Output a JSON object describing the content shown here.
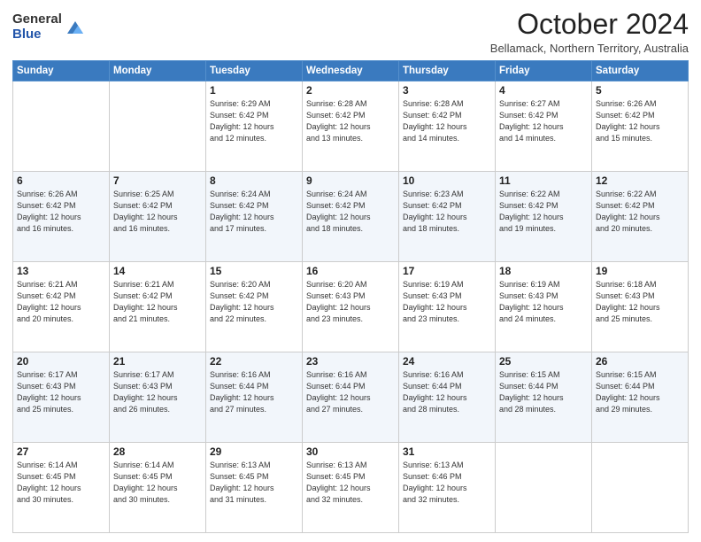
{
  "logo": {
    "general": "General",
    "blue": "Blue"
  },
  "header": {
    "title": "October 2024",
    "subtitle": "Bellamack, Northern Territory, Australia"
  },
  "days_of_week": [
    "Sunday",
    "Monday",
    "Tuesday",
    "Wednesday",
    "Thursday",
    "Friday",
    "Saturday"
  ],
  "weeks": [
    [
      {
        "day": "",
        "info": ""
      },
      {
        "day": "",
        "info": ""
      },
      {
        "day": "1",
        "info": "Sunrise: 6:29 AM\nSunset: 6:42 PM\nDaylight: 12 hours\nand 12 minutes."
      },
      {
        "day": "2",
        "info": "Sunrise: 6:28 AM\nSunset: 6:42 PM\nDaylight: 12 hours\nand 13 minutes."
      },
      {
        "day": "3",
        "info": "Sunrise: 6:28 AM\nSunset: 6:42 PM\nDaylight: 12 hours\nand 14 minutes."
      },
      {
        "day": "4",
        "info": "Sunrise: 6:27 AM\nSunset: 6:42 PM\nDaylight: 12 hours\nand 14 minutes."
      },
      {
        "day": "5",
        "info": "Sunrise: 6:26 AM\nSunset: 6:42 PM\nDaylight: 12 hours\nand 15 minutes."
      }
    ],
    [
      {
        "day": "6",
        "info": "Sunrise: 6:26 AM\nSunset: 6:42 PM\nDaylight: 12 hours\nand 16 minutes."
      },
      {
        "day": "7",
        "info": "Sunrise: 6:25 AM\nSunset: 6:42 PM\nDaylight: 12 hours\nand 16 minutes."
      },
      {
        "day": "8",
        "info": "Sunrise: 6:24 AM\nSunset: 6:42 PM\nDaylight: 12 hours\nand 17 minutes."
      },
      {
        "day": "9",
        "info": "Sunrise: 6:24 AM\nSunset: 6:42 PM\nDaylight: 12 hours\nand 18 minutes."
      },
      {
        "day": "10",
        "info": "Sunrise: 6:23 AM\nSunset: 6:42 PM\nDaylight: 12 hours\nand 18 minutes."
      },
      {
        "day": "11",
        "info": "Sunrise: 6:22 AM\nSunset: 6:42 PM\nDaylight: 12 hours\nand 19 minutes."
      },
      {
        "day": "12",
        "info": "Sunrise: 6:22 AM\nSunset: 6:42 PM\nDaylight: 12 hours\nand 20 minutes."
      }
    ],
    [
      {
        "day": "13",
        "info": "Sunrise: 6:21 AM\nSunset: 6:42 PM\nDaylight: 12 hours\nand 20 minutes."
      },
      {
        "day": "14",
        "info": "Sunrise: 6:21 AM\nSunset: 6:42 PM\nDaylight: 12 hours\nand 21 minutes."
      },
      {
        "day": "15",
        "info": "Sunrise: 6:20 AM\nSunset: 6:42 PM\nDaylight: 12 hours\nand 22 minutes."
      },
      {
        "day": "16",
        "info": "Sunrise: 6:20 AM\nSunset: 6:43 PM\nDaylight: 12 hours\nand 23 minutes."
      },
      {
        "day": "17",
        "info": "Sunrise: 6:19 AM\nSunset: 6:43 PM\nDaylight: 12 hours\nand 23 minutes."
      },
      {
        "day": "18",
        "info": "Sunrise: 6:19 AM\nSunset: 6:43 PM\nDaylight: 12 hours\nand 24 minutes."
      },
      {
        "day": "19",
        "info": "Sunrise: 6:18 AM\nSunset: 6:43 PM\nDaylight: 12 hours\nand 25 minutes."
      }
    ],
    [
      {
        "day": "20",
        "info": "Sunrise: 6:17 AM\nSunset: 6:43 PM\nDaylight: 12 hours\nand 25 minutes."
      },
      {
        "day": "21",
        "info": "Sunrise: 6:17 AM\nSunset: 6:43 PM\nDaylight: 12 hours\nand 26 minutes."
      },
      {
        "day": "22",
        "info": "Sunrise: 6:16 AM\nSunset: 6:44 PM\nDaylight: 12 hours\nand 27 minutes."
      },
      {
        "day": "23",
        "info": "Sunrise: 6:16 AM\nSunset: 6:44 PM\nDaylight: 12 hours\nand 27 minutes."
      },
      {
        "day": "24",
        "info": "Sunrise: 6:16 AM\nSunset: 6:44 PM\nDaylight: 12 hours\nand 28 minutes."
      },
      {
        "day": "25",
        "info": "Sunrise: 6:15 AM\nSunset: 6:44 PM\nDaylight: 12 hours\nand 28 minutes."
      },
      {
        "day": "26",
        "info": "Sunrise: 6:15 AM\nSunset: 6:44 PM\nDaylight: 12 hours\nand 29 minutes."
      }
    ],
    [
      {
        "day": "27",
        "info": "Sunrise: 6:14 AM\nSunset: 6:45 PM\nDaylight: 12 hours\nand 30 minutes."
      },
      {
        "day": "28",
        "info": "Sunrise: 6:14 AM\nSunset: 6:45 PM\nDaylight: 12 hours\nand 30 minutes."
      },
      {
        "day": "29",
        "info": "Sunrise: 6:13 AM\nSunset: 6:45 PM\nDaylight: 12 hours\nand 31 minutes."
      },
      {
        "day": "30",
        "info": "Sunrise: 6:13 AM\nSunset: 6:45 PM\nDaylight: 12 hours\nand 32 minutes."
      },
      {
        "day": "31",
        "info": "Sunrise: 6:13 AM\nSunset: 6:46 PM\nDaylight: 12 hours\nand 32 minutes."
      },
      {
        "day": "",
        "info": ""
      },
      {
        "day": "",
        "info": ""
      }
    ]
  ]
}
